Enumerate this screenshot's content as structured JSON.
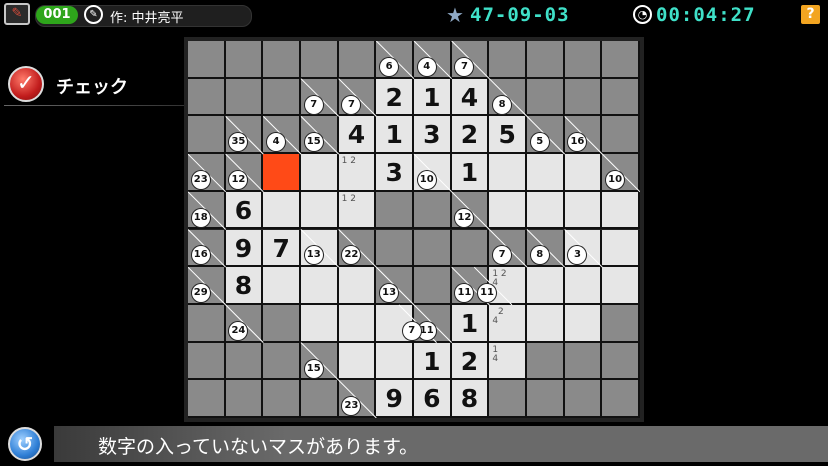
{
  "header": {
    "puzzle_number": "001",
    "author": "作: 中井亮平",
    "puzzle_id": "47-09-03",
    "timer": "00:04:27",
    "help_label": "?",
    "colors": {
      "accent": "#3fe0c8",
      "badge": "#2ea51b",
      "help": "#f3a521"
    }
  },
  "check": {
    "label": "チェック"
  },
  "message": {
    "text": "数字の入っていないマスがあります。"
  },
  "board": {
    "rows": 10,
    "cols": 12,
    "cells": [
      "BBBBBBBBBBBB",
      "BBBBBBBBBBBB",
      "BBBBBBBBBBBB",
      "BBRWWWWWWWWB",
      "BBWWWBBBWWWW",
      "BBWWBBBBBBWW",
      "BBWWWBBBWWWW",
      "BBBWWWBWWWWB",
      "BBBBWWWWWBBB",
      "BBBBBWWWBBBB"
    ],
    "values": [
      {
        "r": 1,
        "c": 5,
        "v": "2"
      },
      {
        "r": 1,
        "c": 6,
        "v": "1"
      },
      {
        "r": 1,
        "c": 7,
        "v": "4"
      },
      {
        "r": 2,
        "c": 4,
        "v": "4"
      },
      {
        "r": 2,
        "c": 5,
        "v": "1"
      },
      {
        "r": 2,
        "c": 6,
        "v": "3"
      },
      {
        "r": 2,
        "c": 7,
        "v": "2"
      },
      {
        "r": 2,
        "c": 8,
        "v": "5"
      },
      {
        "r": 3,
        "c": 5,
        "v": "3"
      },
      {
        "r": 3,
        "c": 7,
        "v": "1"
      },
      {
        "r": 4,
        "c": 1,
        "v": "6"
      },
      {
        "r": 5,
        "c": 1,
        "v": "9"
      },
      {
        "r": 5,
        "c": 2,
        "v": "7"
      },
      {
        "r": 6,
        "c": 1,
        "v": "8"
      },
      {
        "r": 7,
        "c": 7,
        "v": "1"
      },
      {
        "r": 8,
        "c": 6,
        "v": "1"
      },
      {
        "r": 8,
        "c": 7,
        "v": "2"
      },
      {
        "r": 9,
        "c": 5,
        "v": "9"
      },
      {
        "r": 9,
        "c": 6,
        "v": "6"
      },
      {
        "r": 9,
        "c": 7,
        "v": "8"
      }
    ],
    "memos": [
      {
        "r": 3,
        "c": 4,
        "v": "1 2"
      },
      {
        "r": 4,
        "c": 4,
        "v": "1 2"
      },
      {
        "r": 6,
        "c": 8,
        "v": "1 2\n4"
      },
      {
        "r": 7,
        "c": 8,
        "v": "  2\n4"
      },
      {
        "r": 8,
        "c": 8,
        "v": "1\n4"
      }
    ],
    "clues": [
      {
        "r": 0,
        "c": 5,
        "v": "6"
      },
      {
        "r": 0,
        "c": 6,
        "v": "4"
      },
      {
        "r": 0,
        "c": 7,
        "v": "7"
      },
      {
        "r": 1,
        "c": 4,
        "v": "7"
      },
      {
        "r": 1,
        "c": 3,
        "v": "7"
      },
      {
        "r": 1,
        "c": 8,
        "v": "8"
      },
      {
        "r": 2,
        "c": 3,
        "v": "15"
      },
      {
        "r": 2,
        "c": 2,
        "v": "4"
      },
      {
        "r": 2,
        "c": 1,
        "v": "35"
      },
      {
        "r": 2,
        "c": 9,
        "v": "5"
      },
      {
        "r": 2,
        "c": 10,
        "v": "16"
      },
      {
        "r": 3,
        "c": 1,
        "v": "12"
      },
      {
        "r": 3,
        "c": 0,
        "v": "23"
      },
      {
        "r": 3,
        "c": 6,
        "v": "10"
      },
      {
        "r": 3,
        "c": 11,
        "v": "10"
      },
      {
        "r": 4,
        "c": 0,
        "v": "18"
      },
      {
        "r": 4,
        "c": 7,
        "v": "12"
      },
      {
        "r": 5,
        "c": 0,
        "v": "16"
      },
      {
        "r": 5,
        "c": 3,
        "v": "13"
      },
      {
        "r": 5,
        "c": 4,
        "v": "22"
      },
      {
        "r": 5,
        "c": 8,
        "v": "7"
      },
      {
        "r": 5,
        "c": 9,
        "v": "8"
      },
      {
        "r": 5,
        "c": 10,
        "v": "3"
      },
      {
        "r": 6,
        "c": 0,
        "v": "29"
      },
      {
        "r": 6,
        "c": 5,
        "v": "13"
      },
      {
        "r": 6,
        "c": 7,
        "v": "11"
      },
      {
        "r": 6,
        "c": 7.6,
        "v": "11"
      },
      {
        "r": 7,
        "c": 1,
        "v": "24"
      },
      {
        "r": 7,
        "c": 6,
        "v": "11"
      },
      {
        "r": 7,
        "c": 5.6,
        "v": "7"
      },
      {
        "r": 8,
        "c": 3,
        "v": "15"
      },
      {
        "r": 9,
        "c": 4,
        "v": "23"
      }
    ]
  }
}
